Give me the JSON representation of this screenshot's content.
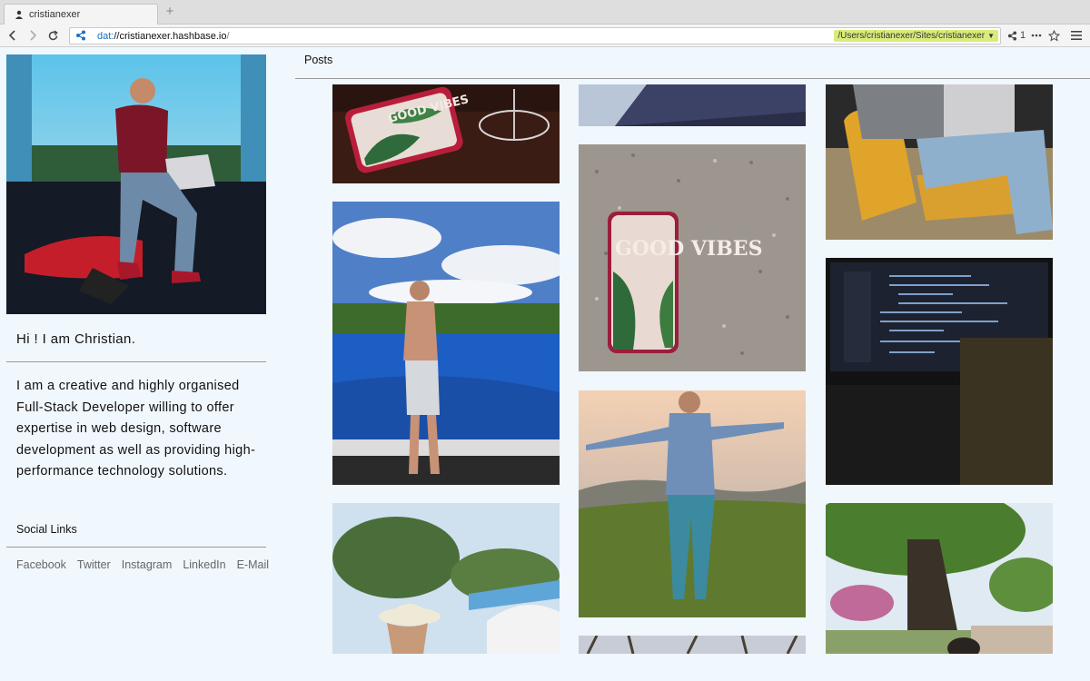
{
  "browser": {
    "tab_title": "cristianexer",
    "new_tab": "+",
    "url_protocol": "dat:",
    "url_host": "//cristianexer.hashbase.io",
    "url_slash": "/",
    "local_path": "/Users/cristianexer/Sites/cristianexer",
    "share_count": "1"
  },
  "profile": {
    "greeting": "Hi ! I am Christian.",
    "bio": "I am a creative and highly organised Full-Stack Developer willing to offer expertise in web design, software development as well as providing high-performance technology solutions.",
    "social_title": "Social Links",
    "links": [
      "Facebook",
      "Twitter",
      "Instagram",
      "LinkedIn",
      "E-Mail"
    ]
  },
  "posts": {
    "tab_label": "Posts",
    "tiles": [
      {
        "caption": "GOOD VIBES"
      },
      {
        "caption": "GOOD VIBES"
      }
    ]
  },
  "colors": {
    "page_bg": "#f0f7fd",
    "link_blue": "#1d6fc4",
    "path_badge": "#d8ec7a"
  }
}
